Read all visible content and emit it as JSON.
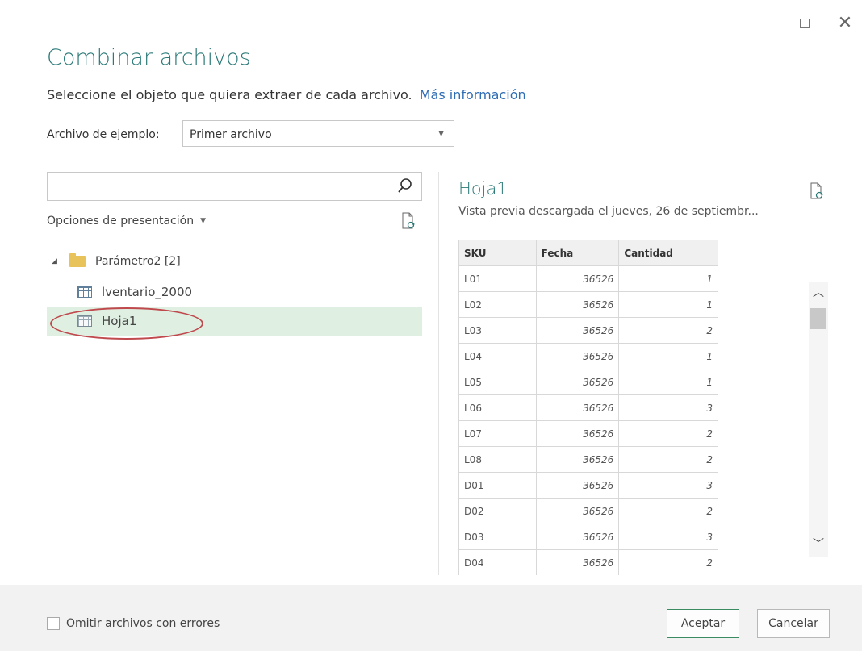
{
  "window": {
    "maximize_label": "",
    "close_label": "✕"
  },
  "dialog": {
    "title": "Combinar archivos",
    "subtitle": "Seleccione el objeto que quiera extraer de cada archivo.",
    "more_info_link": "Más información",
    "sample_file_label": "Archivo de ejemplo:",
    "sample_file_value": "Primer archivo"
  },
  "navigator": {
    "search_value": "",
    "display_options_label": "Opciones de presentación",
    "folder_label": "Parámetro2 [2]",
    "items": [
      {
        "label": "lventario_2000",
        "icon": "table-icon",
        "selected": false
      },
      {
        "label": "Hoja1",
        "icon": "sheet-icon",
        "selected": true
      }
    ]
  },
  "preview": {
    "title": "Hoja1",
    "subtitle": "Vista previa descargada el jueves, 26 de septiembr...",
    "columns": [
      "SKU",
      "Fecha",
      "Cantidad"
    ],
    "rows": [
      [
        "L01",
        "36526",
        "1"
      ],
      [
        "L02",
        "36526",
        "1"
      ],
      [
        "L03",
        "36526",
        "2"
      ],
      [
        "L04",
        "36526",
        "1"
      ],
      [
        "L05",
        "36526",
        "1"
      ],
      [
        "L06",
        "36526",
        "3"
      ],
      [
        "L07",
        "36526",
        "2"
      ],
      [
        "L08",
        "36526",
        "2"
      ],
      [
        "D01",
        "36526",
        "3"
      ],
      [
        "D02",
        "36526",
        "2"
      ],
      [
        "D03",
        "36526",
        "3"
      ],
      [
        "D04",
        "36526",
        "2"
      ]
    ]
  },
  "footer": {
    "skip_errors_label": "Omitir archivos con errores",
    "skip_errors_checked": false,
    "accept_label": "Aceptar",
    "cancel_label": "Cancelar"
  },
  "colors": {
    "accent_title": "#2b7a78",
    "link": "#2f6db5",
    "selected_row": "#dff0e2",
    "highlight_oval": "#c0494e"
  }
}
